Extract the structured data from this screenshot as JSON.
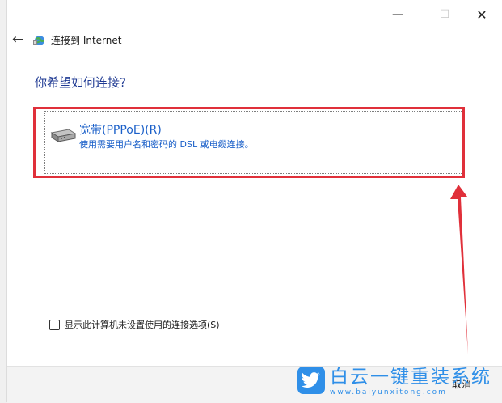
{
  "window": {
    "title": "连接到 Internet",
    "minimize_icon": "minimize-icon",
    "maximize_icon": "maximize-icon",
    "close_icon": "close-icon",
    "back_icon": "back-arrow-icon",
    "window_icon": "network-globe-icon"
  },
  "main": {
    "heading": "你希望如何连接?",
    "options": [
      {
        "title": "宽带(PPPoE)(R)",
        "description": "使用需要用户名和密码的 DSL 或电缆连接。",
        "icon": "modem-icon"
      }
    ],
    "show_unconfigured_label": "显示此计算机未设置使用的连接选项(S)",
    "show_unconfigured_checked": false
  },
  "footer": {
    "cancel_label": "取消"
  },
  "annotation": {
    "highlight_color": "#e0303a",
    "arrow_color": "#e0303a"
  },
  "watermark": {
    "text_cn": "白云一键重装系统",
    "text_en": "www.baiyunxitong.com",
    "color": "#2f8fe8",
    "icon": "twitter-bird-icon"
  }
}
